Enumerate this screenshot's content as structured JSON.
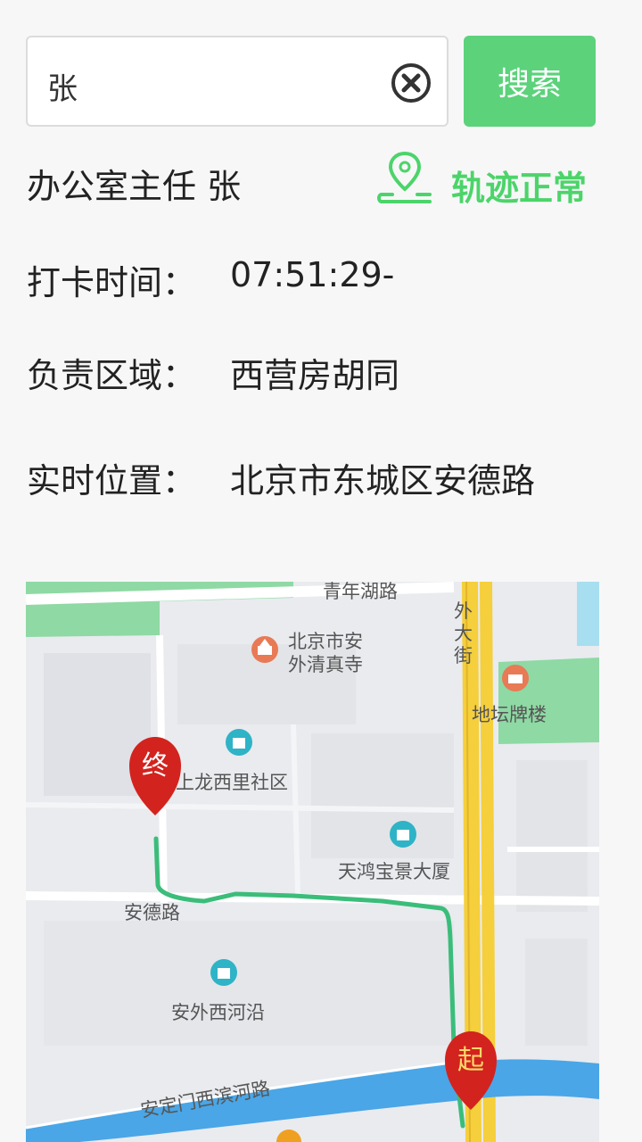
{
  "search": {
    "value": "张",
    "button_label": "搜索"
  },
  "employee": {
    "name": "办公室主任 张",
    "track_status": "轨迹正常"
  },
  "details": [
    {
      "label": "打卡时间：",
      "value": "07:51:29-"
    },
    {
      "label": "负责区域：",
      "value": "西营房胡同"
    },
    {
      "label": "实时位置：",
      "value": "北京市东城区安德路"
    }
  ],
  "map": {
    "labels": {
      "road_top": "青年湖路",
      "street_v1": "外",
      "street_v2": "大",
      "street_v3": "街",
      "poi_mosque_1": "北京市安",
      "poi_mosque_2": "外清真寺",
      "poi_ditan": "地坛牌楼",
      "poi_shanglong": "上龙西里社区",
      "poi_tianhong": "天鸿宝景大厦",
      "road_ande": "安德路",
      "poi_anwai": "安外西河沿",
      "road_river": "安定门西滨河路"
    },
    "markers": {
      "end": "终",
      "start": "起"
    },
    "colors": {
      "route": "#3bbd7a",
      "marker": "#d3231e",
      "road_main": "#f5cf3c",
      "water": "#4aa6e6",
      "park": "#8fd9a4"
    }
  }
}
